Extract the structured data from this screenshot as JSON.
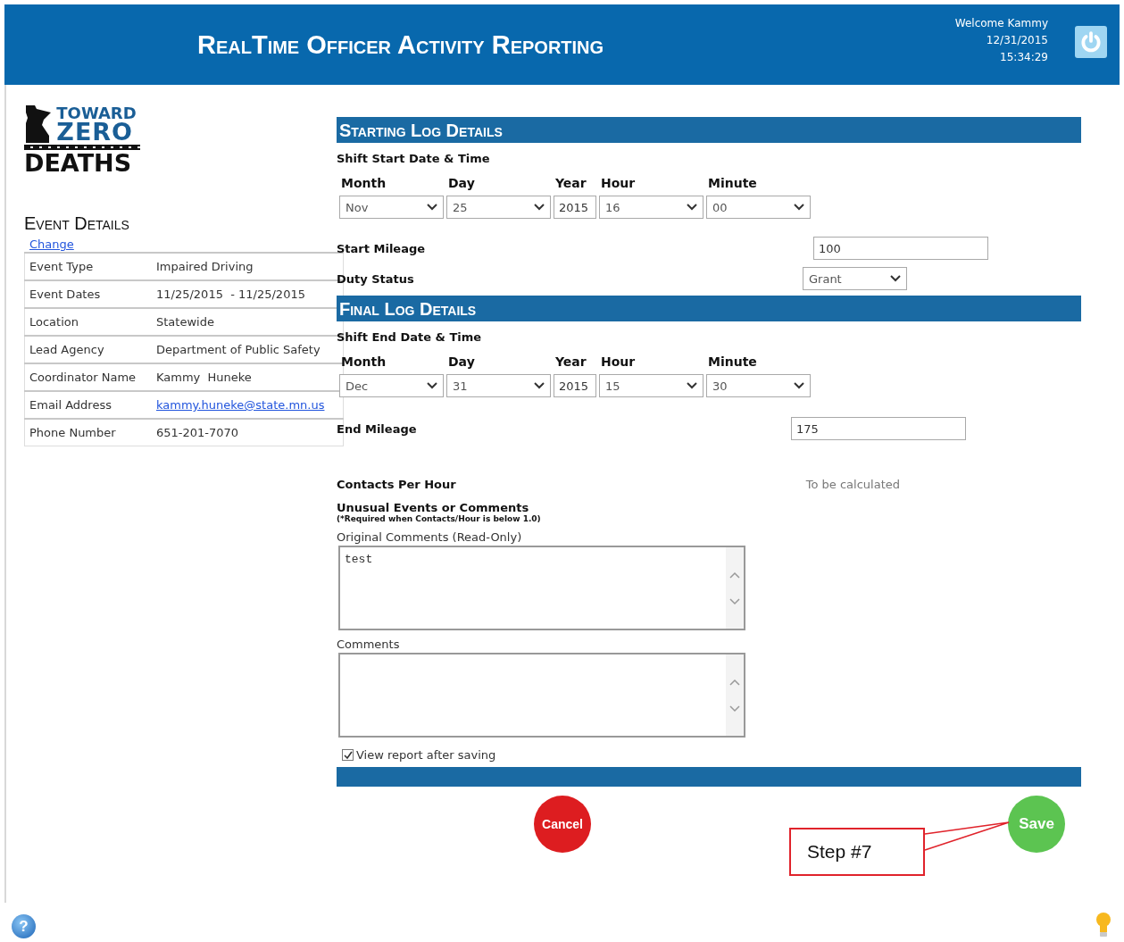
{
  "header": {
    "title": "RealTime Officer Activity Reporting",
    "welcome": "Welcome Kammy",
    "date": "12/31/2015",
    "time": "15:34:29"
  },
  "logo": {
    "lines": [
      "TOWARD",
      "ZERO",
      "DEATHS"
    ]
  },
  "event_details": {
    "heading": "Event Details",
    "change_link": "Change",
    "rows": [
      {
        "label": "Event Type",
        "value": "Impaired Driving",
        "kind": "text"
      },
      {
        "label": "Event Dates",
        "value": "11/25/2015  - 11/25/2015",
        "kind": "text"
      },
      {
        "label": "Location",
        "value": "Statewide",
        "kind": "text"
      },
      {
        "label": "Lead Agency",
        "value": "Department of Public Safety",
        "kind": "text"
      },
      {
        "label": "Coordinator Name",
        "value": "Kammy  Huneke",
        "kind": "text"
      },
      {
        "label": "Email Address",
        "value": "kammy.huneke@state.mn.us",
        "kind": "link"
      },
      {
        "label": "Phone Number",
        "value": "651-201-7070",
        "kind": "text"
      }
    ]
  },
  "starting_log": {
    "heading": "Starting Log Details",
    "subheading": "Shift Start Date & Time",
    "fields": [
      {
        "label": "Month",
        "value": "Nov",
        "kind": "dropdown"
      },
      {
        "label": "Day",
        "value": "25",
        "kind": "dropdown"
      },
      {
        "label": "Year",
        "value": "2015",
        "kind": "text"
      },
      {
        "label": "Hour",
        "value": "16",
        "kind": "dropdown"
      },
      {
        "label": "Minute",
        "value": "00",
        "kind": "dropdown"
      }
    ],
    "start_mileage": {
      "label": "Start Mileage",
      "value": "100"
    },
    "duty_status": {
      "label": "Duty Status",
      "value": "Grant"
    }
  },
  "final_log": {
    "heading": "Final Log Details",
    "subheading": "Shift End Date & Time",
    "fields": [
      {
        "label": "Month",
        "value": "Dec",
        "kind": "dropdown"
      },
      {
        "label": "Day",
        "value": "31",
        "kind": "dropdown"
      },
      {
        "label": "Year",
        "value": "2015",
        "kind": "text"
      },
      {
        "label": "Hour",
        "value": "15",
        "kind": "dropdown"
      },
      {
        "label": "Minute",
        "value": "30",
        "kind": "dropdown"
      }
    ],
    "end_mileage": {
      "label": "End Mileage",
      "value": "175"
    },
    "contacts_per_hour": {
      "label": "Contacts Per Hour",
      "value": "To be calculated"
    },
    "unusual": {
      "label": "Unusual Events or Comments",
      "note": "(*Required when Contacts/Hour is below 1.0)"
    },
    "original_comments": {
      "label": "Original Comments (Read-Only)",
      "value": "test"
    },
    "comments": {
      "label": "Comments"
    },
    "view_report": {
      "label": "View report after saving",
      "checked": true
    }
  },
  "buttons": [
    {
      "label": "Cancel",
      "kind": "cancel"
    },
    {
      "label": "Save",
      "kind": "save"
    }
  ],
  "callout": {
    "label": "Step #7"
  },
  "help": {
    "label": "?"
  }
}
